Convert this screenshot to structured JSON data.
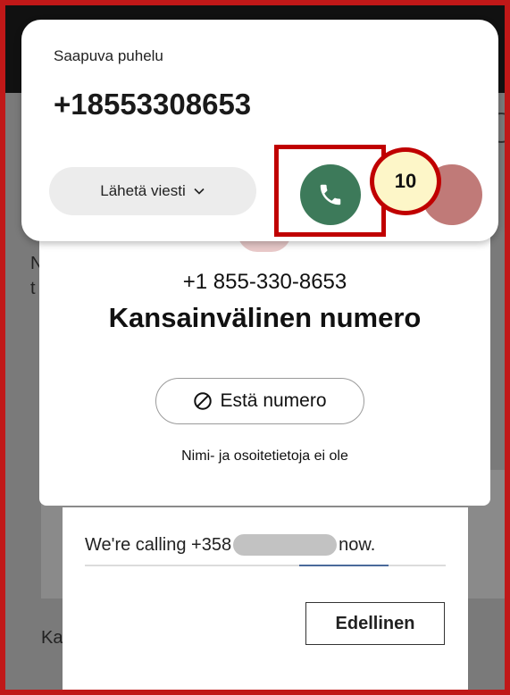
{
  "incoming_call": {
    "label": "Saapuva puhelu",
    "number": "+18553308653",
    "send_message_label": "Lähetä viesti"
  },
  "contact": {
    "number": "+1 855-330-8653",
    "title": "Kansainvälinen numero",
    "block_label": "Estä numero",
    "no_info": "Nimi- ja osoitetietoja ei ole"
  },
  "calling": {
    "prefix": "We're calling +358",
    "suffix": "now.",
    "previous_label": "Edellinen"
  },
  "background": {
    "edge_text_1": "N",
    "edge_text_2": "t",
    "bottom_text": "Ka"
  },
  "annotation": {
    "step": "10"
  },
  "colors": {
    "answer": "#3d7a5a",
    "decline": "#c07a78",
    "highlight": "#c00000",
    "badge_fill": "#fdf6c8"
  },
  "icons": [
    "phone-icon",
    "block-icon",
    "chevron-down-icon"
  ]
}
